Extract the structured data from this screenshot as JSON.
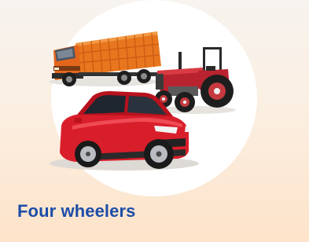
{
  "card": {
    "title": "Four wheelers",
    "image_subjects": [
      "truck",
      "tractor",
      "car"
    ],
    "colors": {
      "title": "#1c4da8",
      "background_top": "#f7f3ef",
      "background_bottom": "#fde3c9",
      "truck_body": "#e8761f",
      "tractor_body": "#b8232f",
      "car_body": "#d91e2b"
    }
  }
}
